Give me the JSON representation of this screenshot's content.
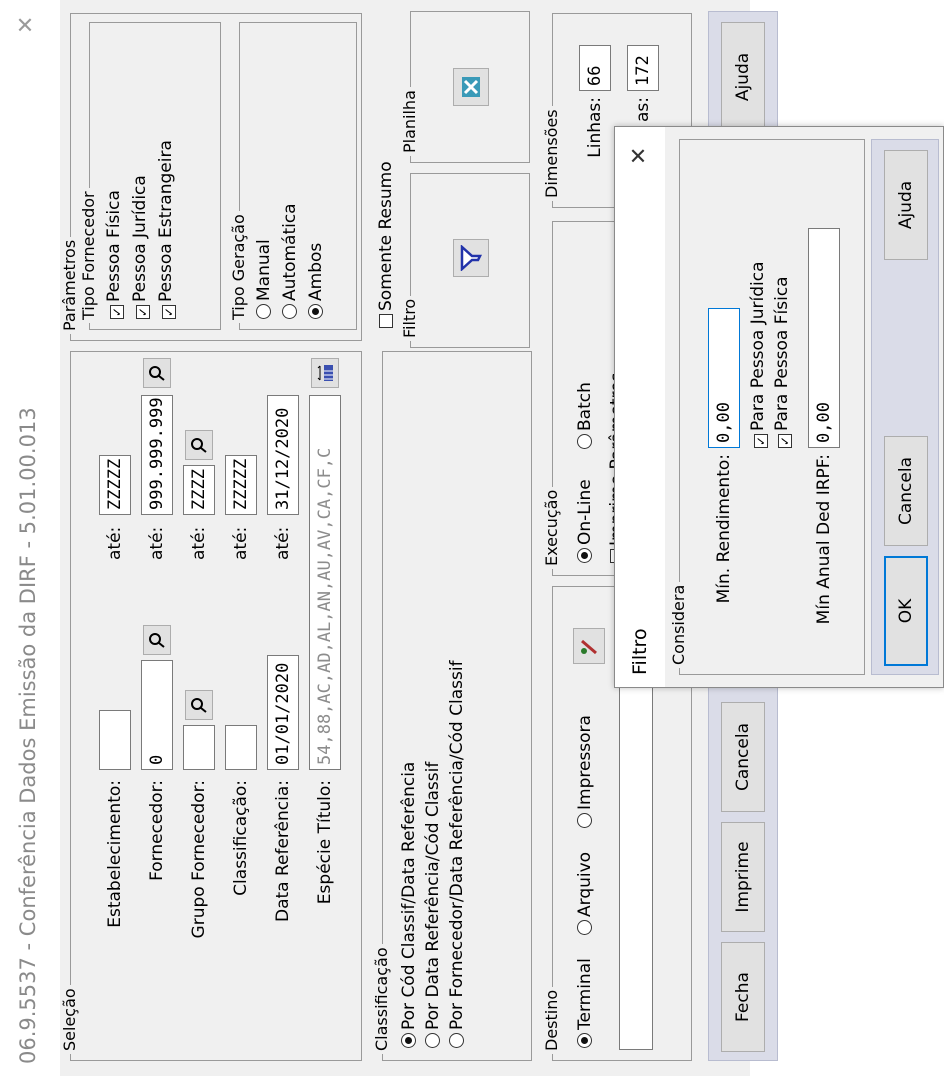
{
  "window": {
    "title": "06.9.5537 - Conferência Dados Emissão da DIRF - 5.01.00.013",
    "close_glyph": "✕"
  },
  "selecao": {
    "title": "Seleção",
    "estabelecimento": {
      "label": "Estabelecimento:",
      "from": "",
      "to_label": "até:",
      "to": "ZZZZZ"
    },
    "fornecedor": {
      "label": "Fornecedor:",
      "from": "0",
      "to_label": "até:",
      "to": "999.999.999"
    },
    "grupo_fornecedor": {
      "label": "Grupo Fornecedor:",
      "from": "",
      "to_label": "até:",
      "to": "ZZZZ"
    },
    "classificacao": {
      "label": "Classificação:",
      "from": "",
      "to_label": "até:",
      "to": "ZZZZZ"
    },
    "data_referencia": {
      "label": "Data Referência:",
      "from": "01/01/2020",
      "to_label": "até:",
      "to": "31/12/2020"
    },
    "especie_titulo": {
      "label": "Espécie Título:",
      "value": "54,88,AC,AD,AL,AN,AU,AV,CA,CF,C"
    }
  },
  "parametros": {
    "title": "Parâmetros",
    "tipo_fornecedor": {
      "title": "Tipo Fornecedor",
      "options": [
        {
          "label": "Pessoa Física",
          "checked": true
        },
        {
          "label": "Pessoa Jurídica",
          "checked": true
        },
        {
          "label": "Pessoa Estrangeira",
          "checked": true
        }
      ]
    },
    "tipo_geracao": {
      "title": "Tipo Geração",
      "options": [
        {
          "label": "Manual",
          "selected": false
        },
        {
          "label": "Automática",
          "selected": false
        },
        {
          "label": "Ambos",
          "selected": true
        }
      ]
    },
    "somente_resumo": {
      "label": "Somente Resumo",
      "checked": false
    }
  },
  "planilha": {
    "title": "Planilha"
  },
  "filtro_box": {
    "title": "Filtro"
  },
  "dimensoes": {
    "title": "Dimensões",
    "linhas_label": "Linhas:",
    "linhas": "66",
    "colunas_label": "as:",
    "colunas": "172"
  },
  "classificacao": {
    "title": "Classificação",
    "options": [
      {
        "label": "Por Cód Classif/Data Referência",
        "selected": true
      },
      {
        "label": "Por Data Referência/Cód Classif",
        "selected": false
      },
      {
        "label": "Por Fornecedor/Data Referência/Cód Classif",
        "selected": false
      }
    ]
  },
  "execucao": {
    "title": "Execução",
    "options": [
      {
        "label": "On-Line",
        "selected": true
      },
      {
        "label": "Batch",
        "selected": false
      }
    ],
    "imprime_parametros": {
      "label": "Imprime Parâmetros",
      "checked": false
    }
  },
  "destino": {
    "title": "Destino",
    "options": [
      {
        "label": "Terminal",
        "selected": true
      },
      {
        "label": "Arquivo",
        "selected": false
      },
      {
        "label": "Impressora",
        "selected": false
      }
    ],
    "path": ""
  },
  "buttons": {
    "fecha": "Fecha",
    "imprime": "Imprime",
    "cancela": "Cancela",
    "ajuda": "Ajuda"
  },
  "filtro_dialog": {
    "title": "Filtro",
    "close_glyph": "✕",
    "considera": {
      "title": "Considera",
      "min_rendimento_label": "Mín. Rendimento:",
      "min_rendimento": "0,00",
      "para_pj": {
        "label": "Para Pessoa Jurídica",
        "checked": true
      },
      "para_pf": {
        "label": "Para Pessoa Física",
        "checked": true
      },
      "min_anual_label": "Mín Anual Ded IRPF:",
      "min_anual": "0,00"
    },
    "buttons": {
      "ok": "OK",
      "cancela": "Cancela",
      "ajuda": "Ajuda"
    }
  },
  "colors": {
    "window_bg": "#f0f0f0",
    "button_bar": "#dadce8",
    "accent_border": "#0078d7"
  }
}
